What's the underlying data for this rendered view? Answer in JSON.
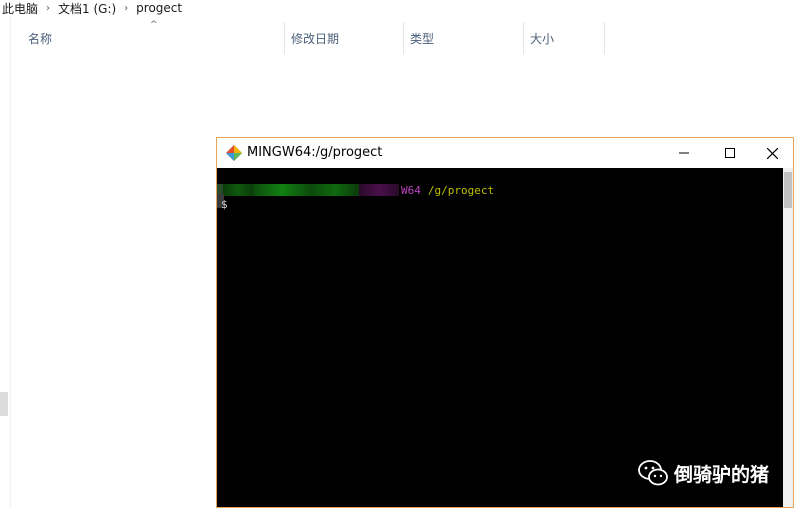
{
  "explorer": {
    "breadcrumb": [
      "此电脑",
      "文档1 (G:)",
      "progect"
    ],
    "columns": [
      "名称",
      "修改日期",
      "类型",
      "大小"
    ]
  },
  "terminal": {
    "title": "MINGW64:/g/progect",
    "prompt_env": "W64",
    "prompt_path": "/g/progect",
    "prompt_symbol": "$",
    "colors": {
      "user_host": "#00bf00",
      "env": "#bf40bf",
      "path": "#bfbf00",
      "background": "#000000"
    }
  },
  "watermark": {
    "text": "倒骑驴的猪",
    "icon": "wechat-icon"
  },
  "icons": {
    "app": "git-bash-icon",
    "minimize": "minimize-icon",
    "maximize": "maximize-icon",
    "close": "close-icon",
    "breadcrumb_separator": "chevron-right-icon",
    "sort": "chevron-up-icon"
  }
}
